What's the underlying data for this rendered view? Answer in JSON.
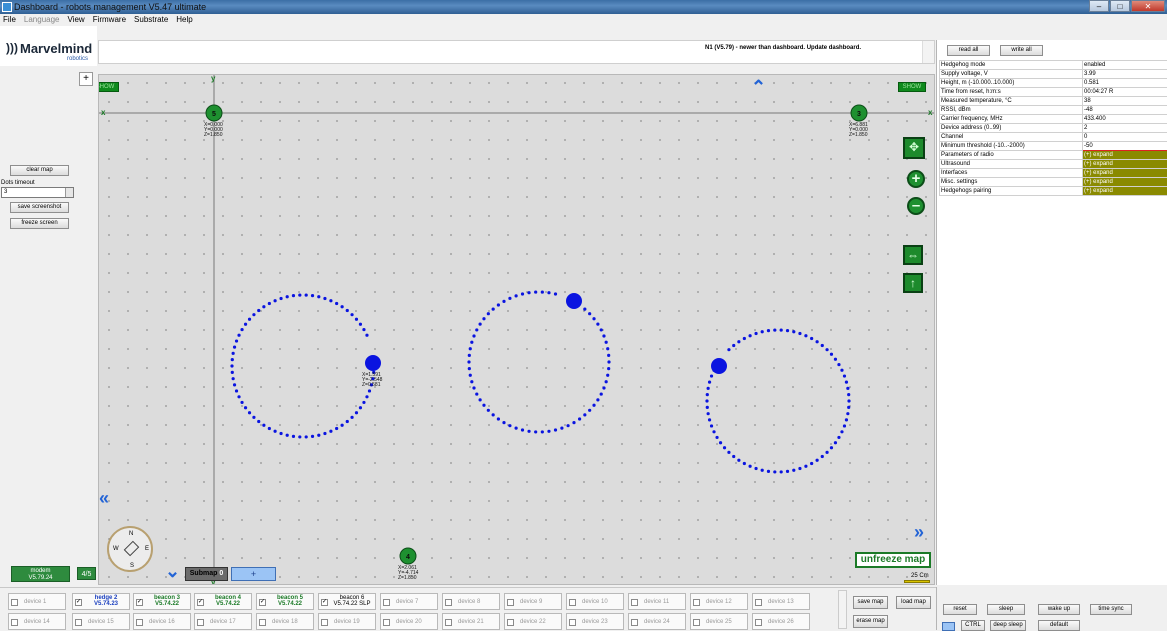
{
  "window": {
    "title": "Dashboard - robots management  V5.47  ultimate",
    "controls": [
      "–",
      "□",
      "✕"
    ]
  },
  "menu": [
    {
      "label": "File",
      "enabled": true
    },
    {
      "label": "Language",
      "enabled": false
    },
    {
      "label": "View",
      "enabled": true
    },
    {
      "label": "Firmware",
      "enabled": true
    },
    {
      "label": "Substrate",
      "enabled": true
    },
    {
      "label": "Help",
      "enabled": true
    }
  ],
  "logo": {
    "brand": "Marvelmind",
    "sub": "robotics",
    "mark": "!"
  },
  "left": {
    "clear_map": "clear map",
    "dots_timeout_label": "Dots timeout",
    "dots_timeout_value": "3",
    "save_screenshot": "save screenshot",
    "freeze_screen": "freeze screen",
    "modem_name": "modem",
    "modem_version": "V5.79.24",
    "modem_badge": "4/5",
    "cross_icon": "+"
  },
  "status": {
    "message": "N1 (V5.79)  - newer than dashboard. Update dashboard."
  },
  "map": {
    "show_left": "SHOW",
    "show_right": "SHOW",
    "axis_x": "x",
    "axis_y": "y",
    "unfreeze": "unfreeze map",
    "scale_label": "25 Cm",
    "submap_label": "Submap",
    "submap_number": "0",
    "submap_add": "+",
    "compass": {
      "n": "N",
      "s": "S",
      "w": "W",
      "e": "E"
    },
    "zoom_in": "+",
    "zoom_out": "–",
    "beacons": [
      {
        "id": "5",
        "lines": [
          "X=0.000",
          "Y=0.000",
          "Z=1.850"
        ]
      },
      {
        "id": "3",
        "lines": [
          "X=6.881",
          "Y=0.000",
          "Z=1.850"
        ]
      },
      {
        "id": "4",
        "lines": [
          "X=2.061",
          "Y=-4.714",
          "Z=1.850"
        ]
      }
    ],
    "hedge_label": [
      "X=1.591",
      "Y=-2.548",
      "Z=0.581"
    ],
    "accent_green": "#1e9030",
    "track_blue": "#0a14e0"
  },
  "right": {
    "read_all": "read all",
    "write_all": "write all",
    "params": [
      {
        "k": "Hedgehog mode",
        "v": "enabled"
      },
      {
        "k": "Supply voltage, V",
        "v": "3.99"
      },
      {
        "k": "Height, m (-10.000..10.000)",
        "v": "0.581"
      },
      {
        "k": "Time from reset, h:m:s",
        "v": "00:04:27   R"
      },
      {
        "k": "Measured temperature, °C",
        "v": "38"
      },
      {
        "k": "RSSI, dBm",
        "v": "-48"
      },
      {
        "k": "Carrier frequency, MHz",
        "v": "433.400"
      },
      {
        "k": "Device address (0..99)",
        "v": "2"
      },
      {
        "k": "Channel",
        "v": "0"
      },
      {
        "k": "Minimum threshold (-10..-2000)",
        "v": "-50"
      },
      {
        "k": "Parameters of radio",
        "v": "(+) expand"
      },
      {
        "k": "Ultrasound",
        "v": "(+) expand"
      },
      {
        "k": "Interfaces",
        "v": "(+) expand"
      },
      {
        "k": "Misc. settings",
        "v": "(+) expand"
      },
      {
        "k": "Hedgehogs pairing",
        "v": "(+) expand"
      }
    ],
    "bottom": {
      "reset": "reset",
      "sleep": "sleep",
      "wake_up": "wake up",
      "time_sync": "time sync",
      "ctrl": "CTRL",
      "deep_sleep": "deep sleep",
      "default": "default"
    }
  },
  "devices_row1": [
    {
      "name": "device 1",
      "kind": "grey",
      "checked": false
    },
    {
      "name": "hedge 2",
      "ver": "V5.74.23",
      "kind": "hedge",
      "checked": true
    },
    {
      "name": "beacon 3",
      "ver": "V5.74.22",
      "kind": "beacon",
      "checked": true
    },
    {
      "name": "beacon 4",
      "ver": "V5.74.22",
      "kind": "beacon",
      "checked": true
    },
    {
      "name": "beacon 5",
      "ver": "V5.74.22",
      "kind": "beacon",
      "checked": true
    },
    {
      "name": "beacon 6",
      "ver": "V5.74.22 SLP",
      "kind": "beacon6",
      "checked": true
    },
    {
      "name": "device 7",
      "kind": "grey",
      "checked": false
    },
    {
      "name": "device 8",
      "kind": "grey",
      "checked": false
    },
    {
      "name": "device 9",
      "kind": "grey",
      "checked": false
    },
    {
      "name": "device 10",
      "kind": "grey",
      "checked": false
    },
    {
      "name": "device 11",
      "kind": "grey",
      "checked": false
    },
    {
      "name": "device 12",
      "kind": "grey",
      "checked": false
    },
    {
      "name": "device 13",
      "kind": "grey",
      "checked": false
    }
  ],
  "devices_row2": [
    {
      "name": "device 14"
    },
    {
      "name": "device 15"
    },
    {
      "name": "device 16"
    },
    {
      "name": "device 17"
    },
    {
      "name": "device 18"
    },
    {
      "name": "device 19"
    },
    {
      "name": "device 20"
    },
    {
      "name": "device 21"
    },
    {
      "name": "device 22"
    },
    {
      "name": "device 23"
    },
    {
      "name": "device 24"
    },
    {
      "name": "device 25"
    },
    {
      "name": "device 26"
    }
  ],
  "device_buttons": {
    "save_map": "save map",
    "load_map": "load map",
    "erase_map": "erase map"
  }
}
